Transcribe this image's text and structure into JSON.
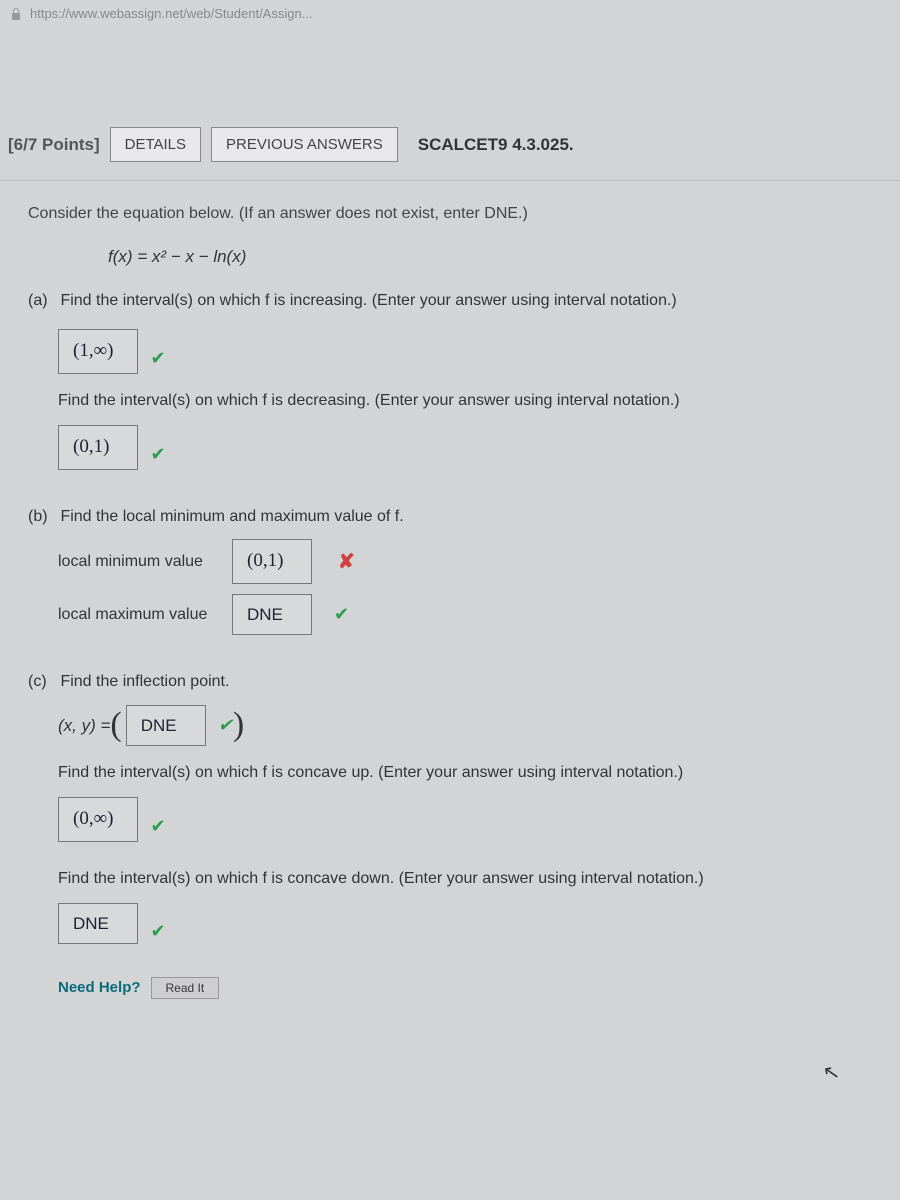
{
  "url": "https://www.webassign.net/web/Student/Assign...",
  "header": {
    "points": "[6/7 Points]",
    "details_btn": "DETAILS",
    "prev_btn": "PREVIOUS ANSWERS",
    "ref": "SCALCET9 4.3.025."
  },
  "question": {
    "instruction": "Consider the equation below. (If an answer does not exist, enter DNE.)",
    "equation": "f(x) = x² − x − ln(x)",
    "parts": {
      "a": {
        "label": "(a)",
        "q1": "Find the interval(s) on which f is increasing. (Enter your answer using interval notation.)",
        "a1": "(1,∞)",
        "q2": "Find the interval(s) on which f is decreasing. (Enter your answer using interval notation.)",
        "a2": "(0,1)"
      },
      "b": {
        "label": "(b)",
        "q": "Find the local minimum and maximum value of f.",
        "min_label": "local minimum value",
        "min_ans": "(0,1)",
        "max_label": "local maximum value",
        "max_ans": "DNE"
      },
      "c": {
        "label": "(c)",
        "q_inflection": "Find the inflection point.",
        "xy_label": "(x, y) = ",
        "xy_ans": "DNE",
        "q_up": "Find the interval(s) on which f is concave up. (Enter your answer using interval notation.)",
        "a_up": "(0,∞)",
        "q_down": "Find the interval(s) on which f is concave down. (Enter your answer using interval notation.)",
        "a_down": "DNE"
      }
    }
  },
  "help": {
    "label": "Need Help?",
    "read_btn": "Read It"
  },
  "marks": {
    "check": "✔",
    "cross": "✘"
  }
}
